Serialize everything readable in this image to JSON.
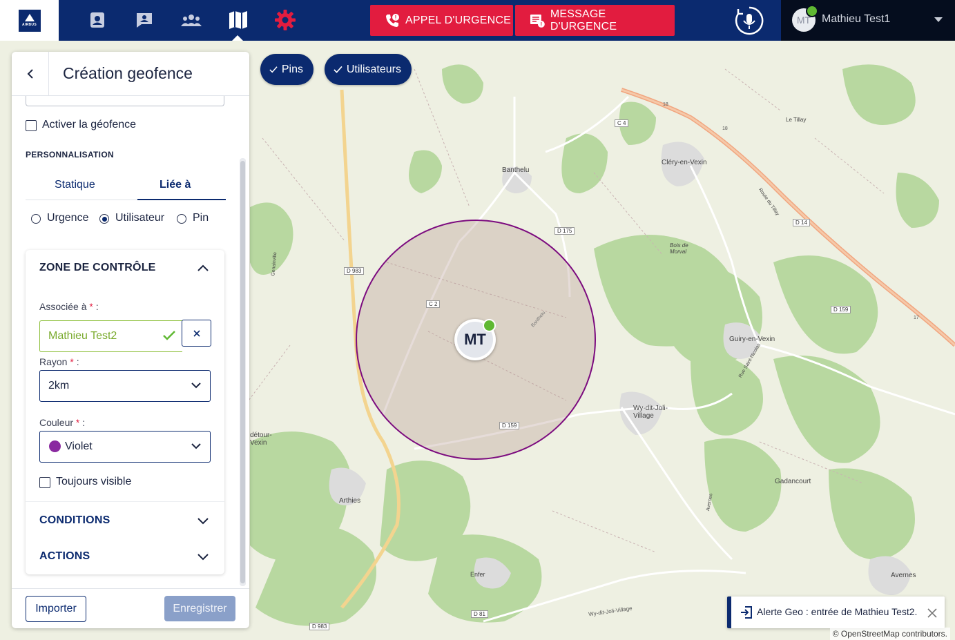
{
  "brand": {
    "logo_text": "AIRBUS"
  },
  "nav": {
    "items": [
      {
        "icon": "contact-card-icon"
      },
      {
        "icon": "messages-icon"
      },
      {
        "icon": "groups-icon"
      },
      {
        "icon": "map-icon",
        "active": true
      },
      {
        "icon": "gear-icon"
      }
    ]
  },
  "emergency": {
    "call_label": "APPEL D'URGENCE",
    "message_label": "MESSAGE D'URGENCE",
    "color": "#e21c3f"
  },
  "user": {
    "initials": "MT",
    "name": "Mathieu Test1",
    "status_color": "#5fb832"
  },
  "map": {
    "filters": [
      {
        "label": "Pins",
        "checked": true
      },
      {
        "label": "Utilisateurs",
        "checked": true
      }
    ],
    "marker": {
      "initials": "MT"
    },
    "place_labels": [
      "Banthelu",
      "Cléry-en-Vexin",
      "Le Tillay",
      "Bois de Morval",
      "Guiry-en-Vexin",
      "Wy-dit-Joli-Village",
      "Gadancourt",
      "Arthies",
      "Enfer",
      "Avernes",
      "Route du Tillay",
      "Rue Saint-Nicolas",
      "Banthelu",
      "Genainville",
      "Avernes",
      "Wy-dit-Joli-Village",
      "détour-Vexin"
    ],
    "road_labels": [
      "C 4",
      "D 175",
      "D 983",
      "C 2",
      "D 14",
      "D 159",
      "D 159",
      "D 81",
      "D 983",
      "18",
      "18",
      "17"
    ],
    "attribution": "© OpenStreetMap contributors."
  },
  "panel": {
    "title": "Création geofence",
    "activate_label": "Activer la géofence",
    "personalisation_label": "PERSONNALISATION",
    "tabs": [
      {
        "label": "Statique",
        "active": false
      },
      {
        "label": "Liée à",
        "active": true
      }
    ],
    "link_options": [
      {
        "label": "Urgence",
        "selected": false
      },
      {
        "label": "Utilisateur",
        "selected": true
      },
      {
        "label": "Pin",
        "selected": false
      }
    ],
    "zone": {
      "title": "ZONE DE CONTRÔLE",
      "associated_label": "Associée à",
      "associated_value": "Mathieu Test2",
      "radius_label": "Rayon",
      "radius_value": "2km",
      "color_label": "Couleur",
      "color_value": "Violet",
      "color_hex": "#8a2aa0",
      "always_visible_label": "Toujours visible",
      "required_mark": "*",
      "colon": " :"
    },
    "conditions_title": "CONDITIONS",
    "actions_title": "ACTIONS",
    "import_label": "Importer",
    "save_label": "Enregistrer"
  },
  "toast": {
    "text": "Alerte Geo : entrée de Mathieu Test2."
  }
}
